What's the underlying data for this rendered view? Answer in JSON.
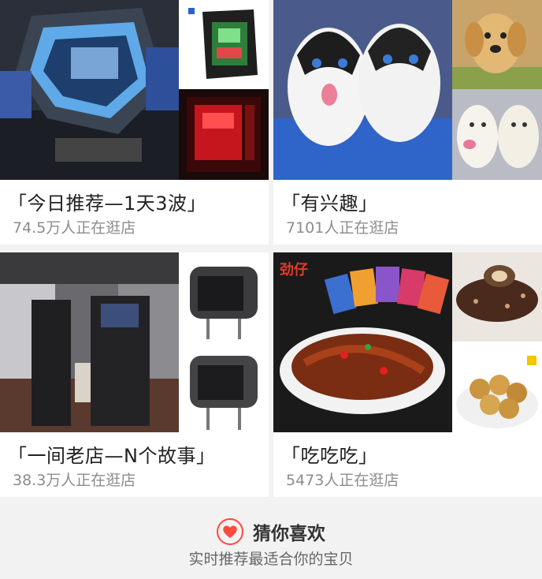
{
  "cards": [
    {
      "title": "「今日推荐—1天3波」",
      "subtitle": "74.5万人正在逛店"
    },
    {
      "title": "「有兴趣」",
      "subtitle": "7101人正在逛店"
    },
    {
      "title": "「一间老店—N个故事」",
      "subtitle": "38.3万人正在逛店"
    },
    {
      "title": "「吃吃吃」",
      "subtitle": "5473人正在逛店"
    }
  ],
  "footer": {
    "title": "猜你喜欢",
    "subtitle": "实时推荐最适合你的宝贝",
    "icon": "heart-icon",
    "accent": "#ff4a3d"
  },
  "brands": {
    "snack_logo": "劲仔"
  }
}
